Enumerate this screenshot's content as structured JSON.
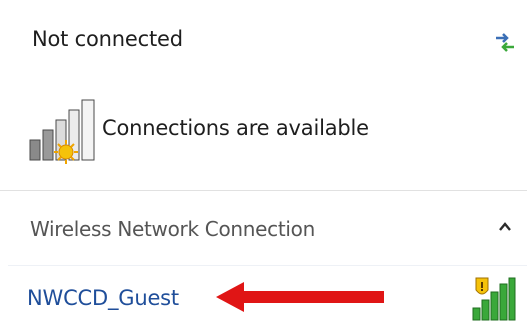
{
  "status": {
    "title": "Not connected",
    "refresh_icon": "refresh-icon"
  },
  "availability": {
    "icon": "network-available-icon",
    "text": "Connections are available"
  },
  "section": {
    "title": "Wireless Network Connection",
    "toggle_icon": "chevron-up-icon"
  },
  "networks": [
    {
      "name": "NWCCD_Guest",
      "secured_icon": "shield-warning-icon",
      "signal_icon": "wifi-signal-icon"
    }
  ],
  "annotation": {
    "arrow_color": "#e01515"
  },
  "colors": {
    "link": "#1f4e9a",
    "accent_green": "#3aa83a",
    "warning_yellow": "#f5c20a"
  }
}
